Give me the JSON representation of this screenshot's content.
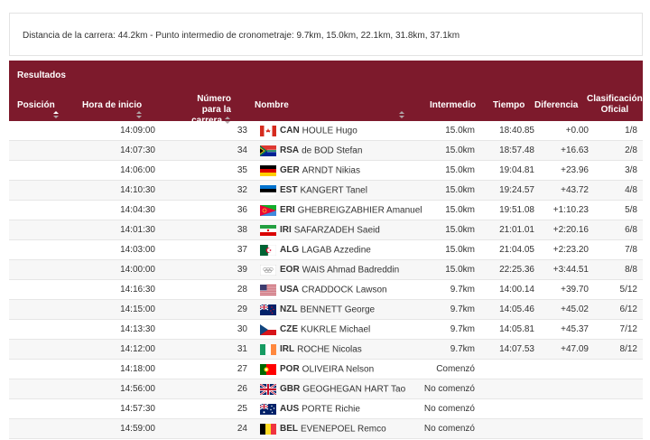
{
  "race_info": "Distancia de la carrera: 44.2km - Punto intermedio de cronometraje: 9.7km, 15.0km, 22.1km, 31.8km, 37.1km",
  "results": {
    "title": "Resultados",
    "columns": {
      "position": "Posición",
      "start_time": "Hora de inicio",
      "race_number_1": "Número",
      "race_number_2": "para la carrera",
      "name": "Nombre",
      "intermediate": "Intermedio",
      "time": "Tiempo",
      "difference": "Diferencia",
      "rank_1": "Clasificación",
      "rank_2": "Oficial"
    },
    "rows": [
      {
        "start": "14:09:00",
        "num": "33",
        "flag": "CAN",
        "code": "CAN",
        "name": "HOULE Hugo",
        "inter": "15.0km",
        "time": "18:40.85",
        "diff": "+0.00",
        "rank": "1/8"
      },
      {
        "start": "14:07:30",
        "num": "34",
        "flag": "RSA",
        "code": "RSA",
        "name": "de BOD Stefan",
        "inter": "15.0km",
        "time": "18:57.48",
        "diff": "+16.63",
        "rank": "2/8"
      },
      {
        "start": "14:06:00",
        "num": "35",
        "flag": "GER",
        "code": "GER",
        "name": "ARNDT Nikias",
        "inter": "15.0km",
        "time": "19:04.81",
        "diff": "+23.96",
        "rank": "3/8"
      },
      {
        "start": "14:10:30",
        "num": "32",
        "flag": "EST",
        "code": "EST",
        "name": "KANGERT Tanel",
        "inter": "15.0km",
        "time": "19:24.57",
        "diff": "+43.72",
        "rank": "4/8"
      },
      {
        "start": "14:04:30",
        "num": "36",
        "flag": "ERI",
        "code": "ERI",
        "name": "GHEBREIGZABHIER Amanuel",
        "inter": "15.0km",
        "time": "19:51.08",
        "diff": "+1:10.23",
        "rank": "5/8"
      },
      {
        "start": "14:01:30",
        "num": "38",
        "flag": "IRI",
        "code": "IRI",
        "name": "SAFARZADEH Saeid",
        "inter": "15.0km",
        "time": "21:01.01",
        "diff": "+2:20.16",
        "rank": "6/8"
      },
      {
        "start": "14:03:00",
        "num": "37",
        "flag": "ALG",
        "code": "ALG",
        "name": "LAGAB Azzedine",
        "inter": "15.0km",
        "time": "21:04.05",
        "diff": "+2:23.20",
        "rank": "7/8"
      },
      {
        "start": "14:00:00",
        "num": "39",
        "flag": "EOR",
        "code": "EOR",
        "name": "WAIS Ahmad Badreddin",
        "inter": "15.0km",
        "time": "22:25.36",
        "diff": "+3:44.51",
        "rank": "8/8"
      },
      {
        "start": "14:16:30",
        "num": "28",
        "flag": "USA",
        "code": "USA",
        "name": "CRADDOCK Lawson",
        "inter": "9.7km",
        "time": "14:00.14",
        "diff": "+39.70",
        "rank": "5/12"
      },
      {
        "start": "14:15:00",
        "num": "29",
        "flag": "NZL",
        "code": "NZL",
        "name": "BENNETT George",
        "inter": "9.7km",
        "time": "14:05.46",
        "diff": "+45.02",
        "rank": "6/12"
      },
      {
        "start": "14:13:30",
        "num": "30",
        "flag": "CZE",
        "code": "CZE",
        "name": "KUKRLE Michael",
        "inter": "9.7km",
        "time": "14:05.81",
        "diff": "+45.37",
        "rank": "7/12"
      },
      {
        "start": "14:12:00",
        "num": "31",
        "flag": "IRL",
        "code": "IRL",
        "name": "ROCHE Nicolas",
        "inter": "9.7km",
        "time": "14:07.53",
        "diff": "+47.09",
        "rank": "8/12"
      },
      {
        "start": "14:18:00",
        "num": "27",
        "flag": "POR",
        "code": "POR",
        "name": "OLIVEIRA Nelson",
        "inter": "Comenzó",
        "time": "",
        "diff": "",
        "rank": ""
      },
      {
        "start": "14:56:00",
        "num": "26",
        "flag": "GBR",
        "code": "GBR",
        "name": "GEOGHEGAN HART Tao",
        "inter": "No comenzó",
        "time": "",
        "diff": "",
        "rank": ""
      },
      {
        "start": "14:57:30",
        "num": "25",
        "flag": "AUS",
        "code": "AUS",
        "name": "PORTE Richie",
        "inter": "No comenzó",
        "time": "",
        "diff": "",
        "rank": ""
      },
      {
        "start": "14:59:00",
        "num": "24",
        "flag": "BEL",
        "code": "BEL",
        "name": "EVENEPOEL Remco",
        "inter": "No comenzó",
        "time": "",
        "diff": "",
        "rank": ""
      }
    ]
  },
  "colors": {
    "header_bg": "#7d1a2c",
    "row_alt": "#f7f7f7"
  }
}
